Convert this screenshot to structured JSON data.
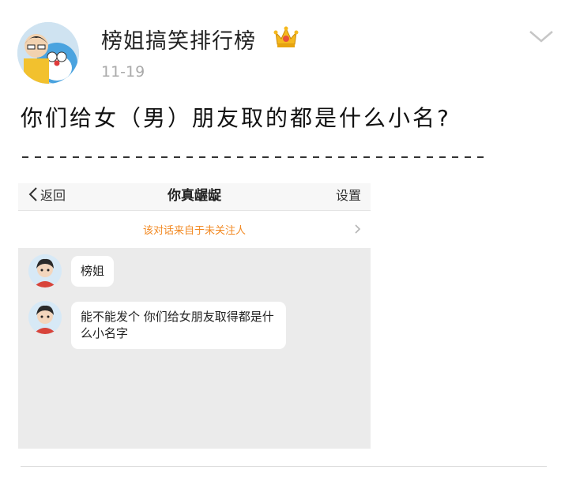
{
  "post": {
    "author": "榜姐搞笑排行榜",
    "time": "11-19",
    "text": "你们给女（男）朋友取的都是什么小名?",
    "author_badge_icon": "crown-icon",
    "expand_icon": "chevron-down-icon"
  },
  "chat": {
    "back_label": "返回",
    "title": "你真龌龊",
    "settings_label": "设置",
    "notice": "该对话来自于未关注人",
    "messages": [
      {
        "text": "榜姐"
      },
      {
        "text": "能不能发个 你们给女朋友取得都是什么小名字"
      }
    ]
  },
  "colors": {
    "notice": "#f28a24",
    "chat_background": "#ebebeb",
    "time": "#aaaaaa"
  }
}
